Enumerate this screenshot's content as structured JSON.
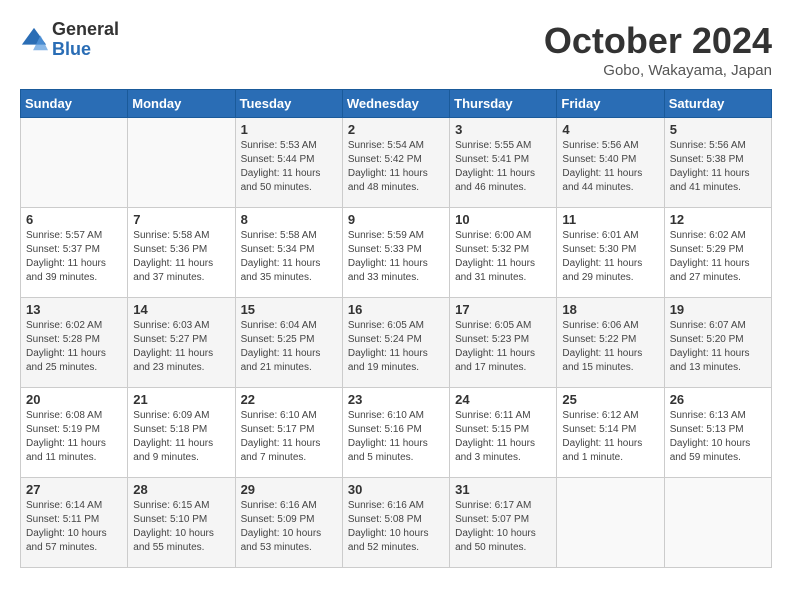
{
  "logo": {
    "general": "General",
    "blue": "Blue"
  },
  "title": {
    "month": "October 2024",
    "location": "Gobo, Wakayama, Japan"
  },
  "weekdays": [
    "Sunday",
    "Monday",
    "Tuesday",
    "Wednesday",
    "Thursday",
    "Friday",
    "Saturday"
  ],
  "weeks": [
    [
      {
        "day": "",
        "detail": ""
      },
      {
        "day": "",
        "detail": ""
      },
      {
        "day": "1",
        "detail": "Sunrise: 5:53 AM\nSunset: 5:44 PM\nDaylight: 11 hours\nand 50 minutes."
      },
      {
        "day": "2",
        "detail": "Sunrise: 5:54 AM\nSunset: 5:42 PM\nDaylight: 11 hours\nand 48 minutes."
      },
      {
        "day": "3",
        "detail": "Sunrise: 5:55 AM\nSunset: 5:41 PM\nDaylight: 11 hours\nand 46 minutes."
      },
      {
        "day": "4",
        "detail": "Sunrise: 5:56 AM\nSunset: 5:40 PM\nDaylight: 11 hours\nand 44 minutes."
      },
      {
        "day": "5",
        "detail": "Sunrise: 5:56 AM\nSunset: 5:38 PM\nDaylight: 11 hours\nand 41 minutes."
      }
    ],
    [
      {
        "day": "6",
        "detail": "Sunrise: 5:57 AM\nSunset: 5:37 PM\nDaylight: 11 hours\nand 39 minutes."
      },
      {
        "day": "7",
        "detail": "Sunrise: 5:58 AM\nSunset: 5:36 PM\nDaylight: 11 hours\nand 37 minutes."
      },
      {
        "day": "8",
        "detail": "Sunrise: 5:58 AM\nSunset: 5:34 PM\nDaylight: 11 hours\nand 35 minutes."
      },
      {
        "day": "9",
        "detail": "Sunrise: 5:59 AM\nSunset: 5:33 PM\nDaylight: 11 hours\nand 33 minutes."
      },
      {
        "day": "10",
        "detail": "Sunrise: 6:00 AM\nSunset: 5:32 PM\nDaylight: 11 hours\nand 31 minutes."
      },
      {
        "day": "11",
        "detail": "Sunrise: 6:01 AM\nSunset: 5:30 PM\nDaylight: 11 hours\nand 29 minutes."
      },
      {
        "day": "12",
        "detail": "Sunrise: 6:02 AM\nSunset: 5:29 PM\nDaylight: 11 hours\nand 27 minutes."
      }
    ],
    [
      {
        "day": "13",
        "detail": "Sunrise: 6:02 AM\nSunset: 5:28 PM\nDaylight: 11 hours\nand 25 minutes."
      },
      {
        "day": "14",
        "detail": "Sunrise: 6:03 AM\nSunset: 5:27 PM\nDaylight: 11 hours\nand 23 minutes."
      },
      {
        "day": "15",
        "detail": "Sunrise: 6:04 AM\nSunset: 5:25 PM\nDaylight: 11 hours\nand 21 minutes."
      },
      {
        "day": "16",
        "detail": "Sunrise: 6:05 AM\nSunset: 5:24 PM\nDaylight: 11 hours\nand 19 minutes."
      },
      {
        "day": "17",
        "detail": "Sunrise: 6:05 AM\nSunset: 5:23 PM\nDaylight: 11 hours\nand 17 minutes."
      },
      {
        "day": "18",
        "detail": "Sunrise: 6:06 AM\nSunset: 5:22 PM\nDaylight: 11 hours\nand 15 minutes."
      },
      {
        "day": "19",
        "detail": "Sunrise: 6:07 AM\nSunset: 5:20 PM\nDaylight: 11 hours\nand 13 minutes."
      }
    ],
    [
      {
        "day": "20",
        "detail": "Sunrise: 6:08 AM\nSunset: 5:19 PM\nDaylight: 11 hours\nand 11 minutes."
      },
      {
        "day": "21",
        "detail": "Sunrise: 6:09 AM\nSunset: 5:18 PM\nDaylight: 11 hours\nand 9 minutes."
      },
      {
        "day": "22",
        "detail": "Sunrise: 6:10 AM\nSunset: 5:17 PM\nDaylight: 11 hours\nand 7 minutes."
      },
      {
        "day": "23",
        "detail": "Sunrise: 6:10 AM\nSunset: 5:16 PM\nDaylight: 11 hours\nand 5 minutes."
      },
      {
        "day": "24",
        "detail": "Sunrise: 6:11 AM\nSunset: 5:15 PM\nDaylight: 11 hours\nand 3 minutes."
      },
      {
        "day": "25",
        "detail": "Sunrise: 6:12 AM\nSunset: 5:14 PM\nDaylight: 11 hours\nand 1 minute."
      },
      {
        "day": "26",
        "detail": "Sunrise: 6:13 AM\nSunset: 5:13 PM\nDaylight: 10 hours\nand 59 minutes."
      }
    ],
    [
      {
        "day": "27",
        "detail": "Sunrise: 6:14 AM\nSunset: 5:11 PM\nDaylight: 10 hours\nand 57 minutes."
      },
      {
        "day": "28",
        "detail": "Sunrise: 6:15 AM\nSunset: 5:10 PM\nDaylight: 10 hours\nand 55 minutes."
      },
      {
        "day": "29",
        "detail": "Sunrise: 6:16 AM\nSunset: 5:09 PM\nDaylight: 10 hours\nand 53 minutes."
      },
      {
        "day": "30",
        "detail": "Sunrise: 6:16 AM\nSunset: 5:08 PM\nDaylight: 10 hours\nand 52 minutes."
      },
      {
        "day": "31",
        "detail": "Sunrise: 6:17 AM\nSunset: 5:07 PM\nDaylight: 10 hours\nand 50 minutes."
      },
      {
        "day": "",
        "detail": ""
      },
      {
        "day": "",
        "detail": ""
      }
    ]
  ]
}
